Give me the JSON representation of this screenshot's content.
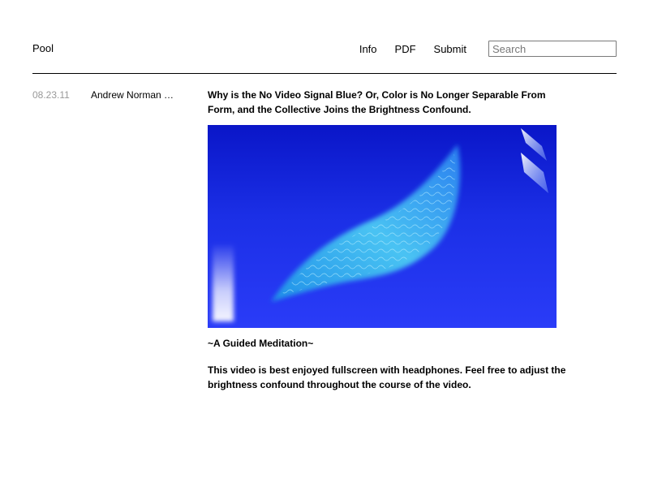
{
  "site": {
    "title": "Pool"
  },
  "nav": {
    "items": [
      "Info",
      "PDF",
      "Submit"
    ],
    "search_placeholder": "Search"
  },
  "post": {
    "date": "08.23.11",
    "author": "Andrew Norman …",
    "title": "Why is the No Video Signal Blue? Or, Color is No Longer Separable From Form, and the Collective Joins the Brightness Confound.",
    "subtitle": "~A Guided Meditation~",
    "description": "This video is best enjoyed fullscreen with headphones. Feel free to adjust the brightness confound throughout the course of the video."
  },
  "colors": {
    "video_background": "#1b2fe6",
    "date_text": "#999999"
  }
}
